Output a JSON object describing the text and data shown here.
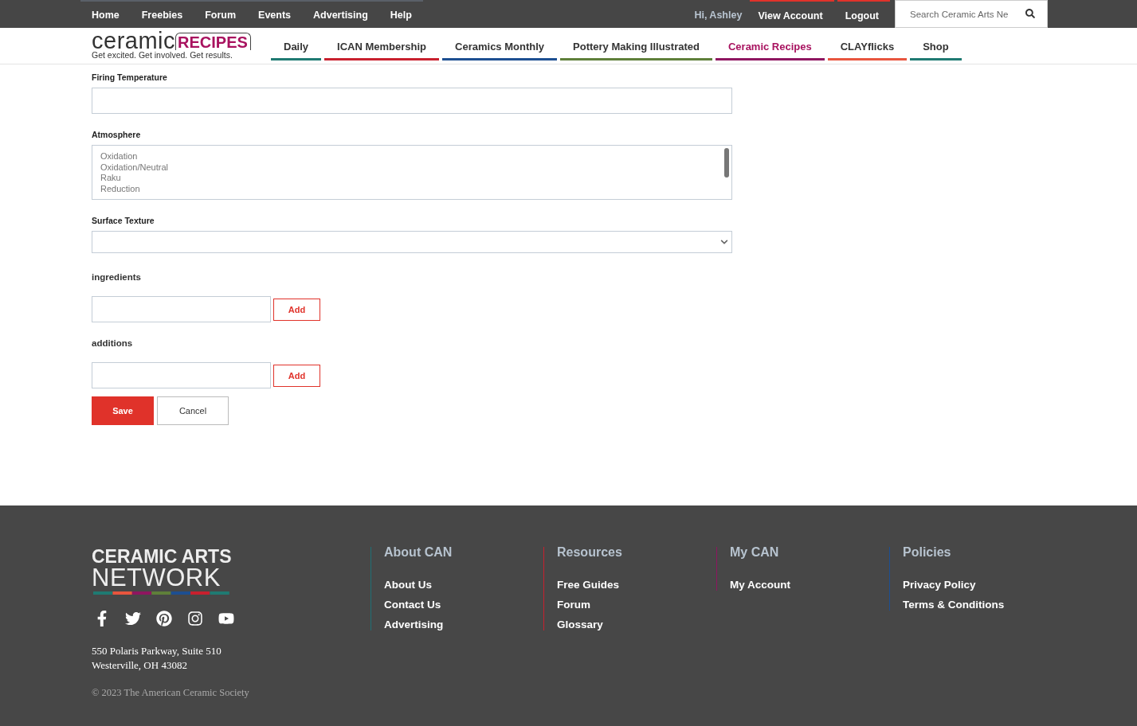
{
  "top_nav": {
    "links": [
      "Home",
      "Freebies",
      "Forum",
      "Events",
      "Advertising",
      "Help"
    ],
    "greeting": "Hi, Ashley",
    "account_links": [
      "View Account",
      "Logout"
    ],
    "search": {
      "placeholder": "Search Ceramic Arts Ne"
    }
  },
  "logo": {
    "word1": "ceramic",
    "word2": "RECIPES",
    "tagline": "Get excited. Get involved. Get results."
  },
  "site_tabs": [
    {
      "label": "Daily",
      "color": "#1f7a72",
      "selected": false
    },
    {
      "label": "ICAN Membership",
      "color": "#c8202e",
      "selected": false
    },
    {
      "label": "Ceramics Monthly",
      "color": "#1d4f91",
      "selected": false
    },
    {
      "label": "Pottery Making Illustrated",
      "color": "#5f7f3a",
      "selected": false
    },
    {
      "label": "Ceramic Recipes",
      "color": "#8e1660",
      "selected": true
    },
    {
      "label": "CLAYflicks",
      "color": "#e8553e",
      "selected": false
    },
    {
      "label": "Shop",
      "color": "#1f7a72",
      "selected": false
    }
  ],
  "form": {
    "fields": [
      {
        "kind": "text",
        "label": "Firing Temperature"
      },
      {
        "kind": "listbox",
        "label": "Atmosphere",
        "options": [
          "Oxidation",
          "Oxidation/Neutral",
          "Raku",
          "Reduction"
        ]
      },
      {
        "kind": "select",
        "label": "Surface Texture"
      },
      {
        "kind": "adder",
        "label": "ingredients",
        "button": "Add"
      },
      {
        "kind": "adder",
        "label": "additions",
        "button": "Add"
      }
    ],
    "buttons": [
      {
        "label": "Save",
        "kind": "primary"
      },
      {
        "label": "Cancel",
        "kind": "secondary"
      }
    ]
  },
  "footer": {
    "logo": {
      "line1": "CERAMIC ARTS",
      "line2": "NETWORK"
    },
    "address": [
      "550 Polaris Parkway, Suite 510",
      "Westerville, OH 43082"
    ],
    "copyright": "© 2023 The American Ceramic Society",
    "columns": [
      {
        "title": "About CAN",
        "color": "#1f6f75",
        "links": [
          "About Us",
          "Contact Us",
          "Advertising"
        ]
      },
      {
        "title": "Resources",
        "color": "#c8202e",
        "links": [
          "Free Guides",
          "Forum",
          "Glossary"
        ]
      },
      {
        "title": "My CAN",
        "color": "#8e1660",
        "links": [
          "My Account"
        ]
      },
      {
        "title": "Policies",
        "color": "#1d4f91",
        "links": [
          "Privacy Policy",
          "Terms & Conditions"
        ]
      }
    ]
  }
}
